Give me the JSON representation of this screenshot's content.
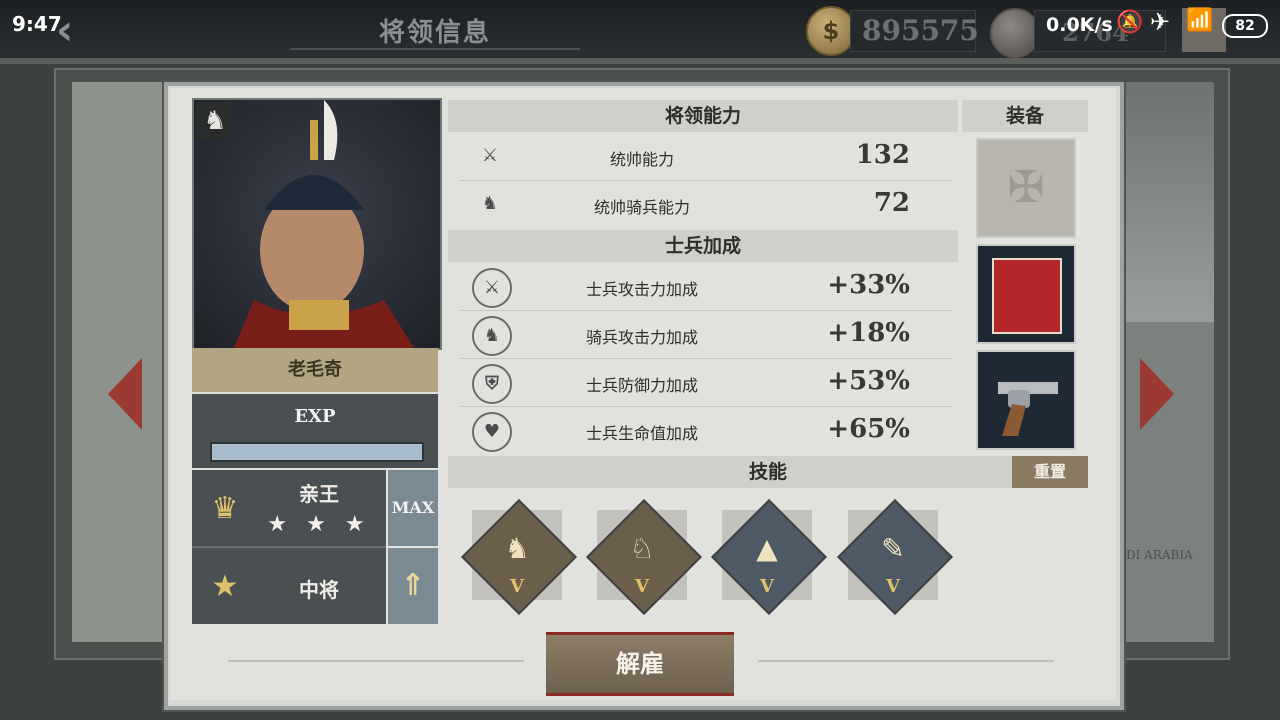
{
  "status_bar": {
    "time": "9:47",
    "network": "0.0K/s",
    "battery": "82"
  },
  "header": {
    "title": "将领信息",
    "gold": "895575",
    "medals": "2764"
  },
  "general": {
    "name": "老毛奇",
    "exp_label": "EXP",
    "exp_progress": 1.0,
    "title_rank": "亲王",
    "stars": "★ ★ ★",
    "stars_count": 3,
    "military_rank": "中将",
    "max_label": "MAX"
  },
  "abilities": {
    "heading": "将领能力",
    "rows": [
      {
        "label": "统帅能力",
        "value": "132",
        "icon": "crossed-swords-icon"
      },
      {
        "label": "统帅骑兵能力",
        "value": "72",
        "icon": "horse-head-icon"
      }
    ]
  },
  "soldier_bonus": {
    "heading": "士兵加成",
    "rows": [
      {
        "label": "士兵攻击力加成",
        "value": "+33%",
        "icon": "attack-up-icon"
      },
      {
        "label": "骑兵攻击力加成",
        "value": "+18%",
        "icon": "cavalry-attack-up-icon"
      },
      {
        "label": "士兵防御力加成",
        "value": "+53%",
        "icon": "shield-up-icon"
      },
      {
        "label": "士兵生命值加成",
        "value": "+65%",
        "icon": "heart-up-icon"
      }
    ]
  },
  "equipment": {
    "heading": "装备",
    "slots": [
      {
        "item": "order-medal-icon",
        "state": "empty"
      },
      {
        "item": "book-icon",
        "state": "equipped"
      },
      {
        "item": "revolver-icon",
        "state": "equipped"
      }
    ]
  },
  "skills": {
    "heading": "技能",
    "reset_label": "重置",
    "items": [
      {
        "icon": "cavalry-target-icon",
        "level": "V",
        "color": "#6b5e4b"
      },
      {
        "icon": "cavalry-charge-icon",
        "level": "V",
        "color": "#6b5e4b"
      },
      {
        "icon": "mountain-icon",
        "level": "V",
        "color": "#4d5a66"
      },
      {
        "icon": "bread-icon",
        "level": "V",
        "color": "#4d5a66"
      }
    ]
  },
  "footer": {
    "dismiss_label": "解雇"
  },
  "map": {
    "region_label": "AUDI ARABIA"
  }
}
